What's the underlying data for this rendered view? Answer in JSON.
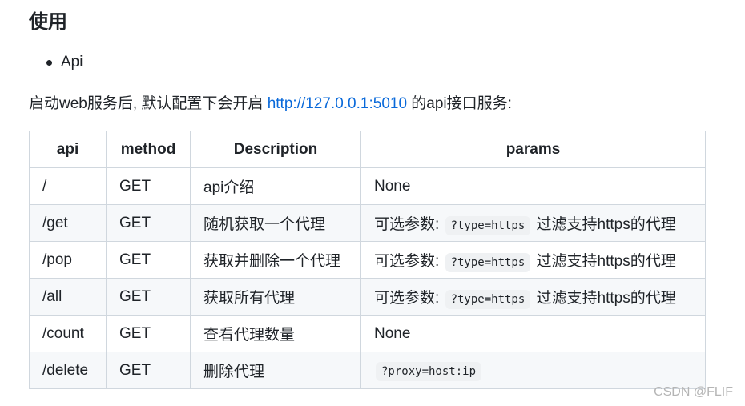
{
  "section_title": "使用",
  "bullets": [
    "Api"
  ],
  "intro": {
    "prefix": "启动web服务后, 默认配置下会开启 ",
    "link_text": "http://127.0.0.1:5010",
    "suffix": " 的api接口服务:"
  },
  "table": {
    "headers": [
      "api",
      "method",
      "Description",
      "params"
    ],
    "rows": [
      {
        "api": "/",
        "method": "GET",
        "desc": "api介绍",
        "param_pre": "None",
        "param_code": "",
        "param_post": ""
      },
      {
        "api": "/get",
        "method": "GET",
        "desc": "随机获取一个代理",
        "param_pre": "可选参数: ",
        "param_code": "?type=https",
        "param_post": " 过滤支持https的代理"
      },
      {
        "api": "/pop",
        "method": "GET",
        "desc": "获取并删除一个代理",
        "param_pre": "可选参数: ",
        "param_code": "?type=https",
        "param_post": " 过滤支持https的代理"
      },
      {
        "api": "/all",
        "method": "GET",
        "desc": "获取所有代理",
        "param_pre": "可选参数: ",
        "param_code": "?type=https",
        "param_post": " 过滤支持https的代理"
      },
      {
        "api": "/count",
        "method": "GET",
        "desc": "查看代理数量",
        "param_pre": "None",
        "param_code": "",
        "param_post": ""
      },
      {
        "api": "/delete",
        "method": "GET",
        "desc": "删除代理",
        "param_pre": "",
        "param_code": "?proxy=host:ip",
        "param_post": ""
      }
    ]
  },
  "watermark": "CSDN @FLIF",
  "colors": {
    "link": "#0969da",
    "border": "#d0d7de",
    "alt_row": "#f6f8fa",
    "code_bg": "#eff1f3"
  }
}
